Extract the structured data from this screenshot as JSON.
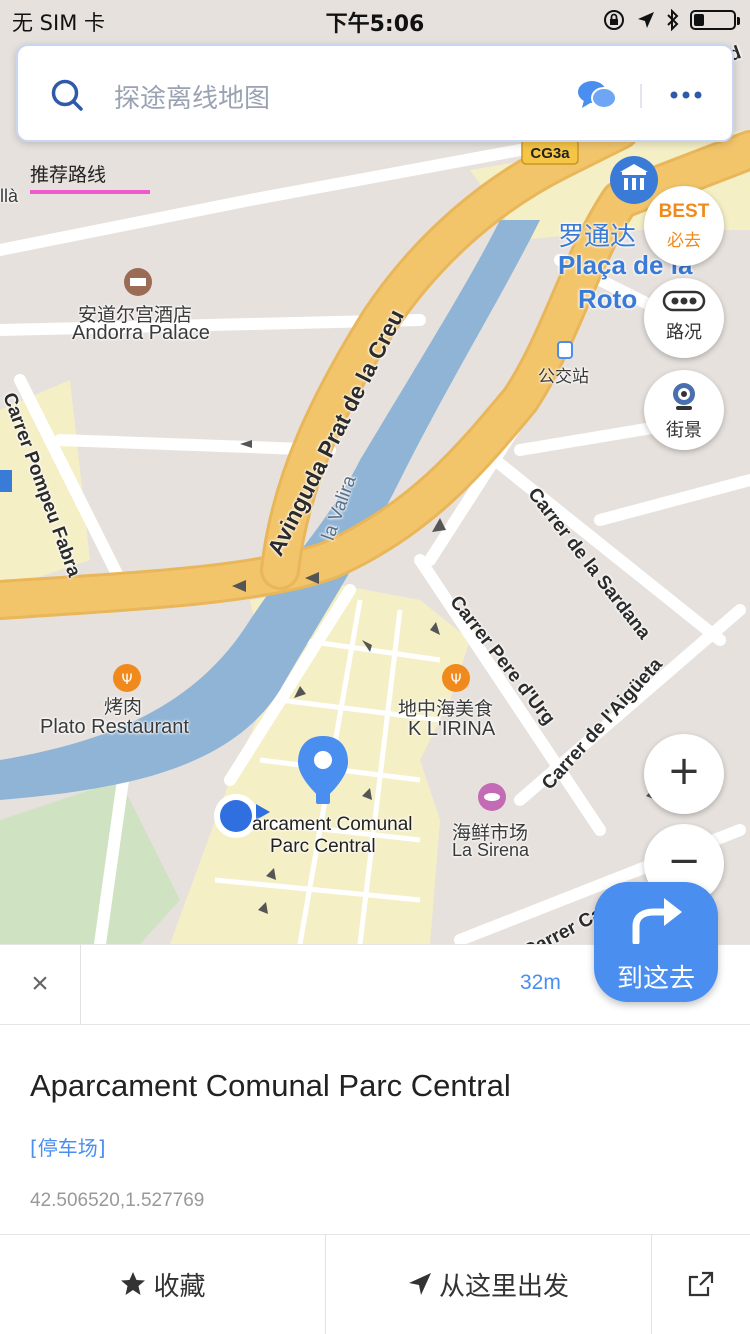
{
  "status_bar": {
    "carrier": "无 SIM 卡",
    "time": "下午5:06",
    "battery_level": 0.25
  },
  "search": {
    "placeholder": "探途离线地图"
  },
  "tabs": {
    "recommend_label": "推荐路线"
  },
  "map": {
    "road_badge": "CG3a",
    "labels": {
      "andorra_palace_cn": "安道尔宫酒店",
      "andorra_palace_en": "Andorra Palace",
      "avinguda": "Avinguda Prat de la Creu",
      "valira": "la Valira",
      "pompeu": "Carrer Pompeu Fabra",
      "sardana": "Carrer de la Sardana",
      "pere_urg": "Carrer Pere d'Urg",
      "aigueta": "Carrer de l'Aigüeta",
      "callaueta": "Carrer Callaueta",
      "bus_stop": "公交站",
      "plato_cn": "烤肉",
      "plato_en": "Plato Restaurant",
      "med_cn": "地中海美食",
      "med_en": "K L'IRINA",
      "fish_cn": "海鲜市场",
      "fish_en": "La Sirena",
      "parking": "Aparcament Comunal Parc Central",
      "parking_line1": "arcament Comunal",
      "parking_line2": "Parc Central",
      "rotonda_cn": "罗通达",
      "rotonda_en1": "Plaça de la",
      "rotonda_en2": "Roto",
      "edge_left": "llà",
      "edge_top": "Avingud"
    }
  },
  "side_buttons": {
    "best_top": "BEST",
    "best_bottom": "必去",
    "traffic": "路况",
    "street_view": "街景",
    "zoom_in": "+",
    "zoom_out": "−",
    "go_here": "到这去"
  },
  "panel": {
    "close": "×",
    "distance": "32m",
    "title": "Aparcament Comunal Parc Central",
    "category": "[停车场]",
    "coords": "42.506520,1.527769",
    "favorite": "收藏",
    "start_here": "从这里出发"
  },
  "colors": {
    "accent": "#4a8ef0",
    "road": "#f2c56b",
    "water": "#8fb4d6",
    "parking_area": "#f5efc6",
    "park": "#cfe3c2",
    "best": "#f08a1c",
    "tab_underline": "#f05ad0"
  }
}
